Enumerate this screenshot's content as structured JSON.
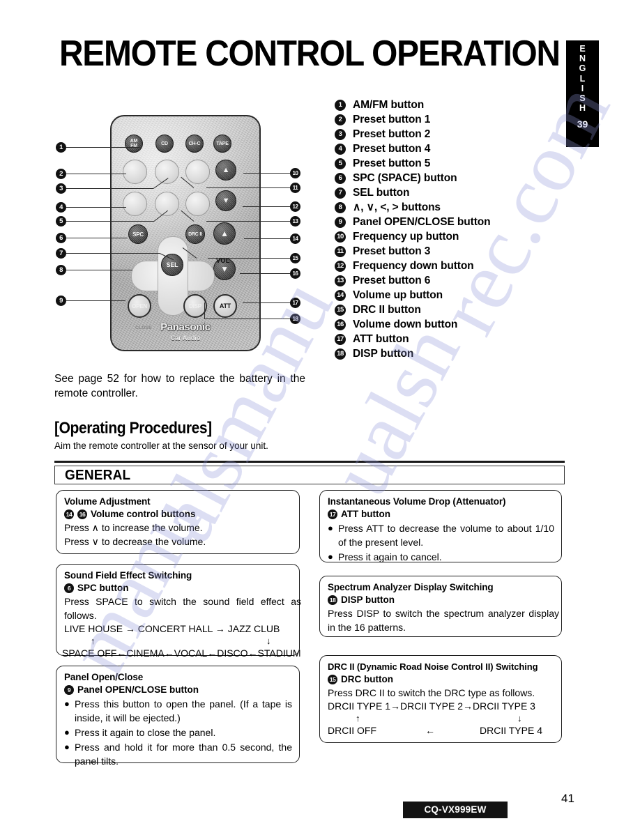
{
  "page": {
    "title": "REMOTE CONTROL OPERATION",
    "number": "41",
    "model_badge": "CQ-VX999EW"
  },
  "english_tab": {
    "letters": [
      "E",
      "N",
      "G",
      "L",
      "I",
      "S",
      "H"
    ],
    "page_ref": "39"
  },
  "remote": {
    "brand": "Panasonic",
    "sub_brand": "Car Audio",
    "vol_label": "VOL",
    "close_label": "CLOSE",
    "top_buttons": [
      "AM\nFM",
      "CD",
      "CH-C",
      "TAPE"
    ],
    "buttons": {
      "spc": "SPC",
      "sel": "SEL",
      "drc": "DRC II",
      "open": "OPEN",
      "disp": "DISP",
      "att": "ATT",
      "vol_up": "▲",
      "vol_down": "▼",
      "freq_up": "▲",
      "freq_down": "▼"
    }
  },
  "legend": [
    {
      "num": "❶",
      "n": "1",
      "label": "AM/FM button"
    },
    {
      "num": "❷",
      "n": "2",
      "label": "Preset button  1"
    },
    {
      "num": "❸",
      "n": "3",
      "label": "Preset button 2"
    },
    {
      "num": "❹",
      "n": "4",
      "label": "Preset button 4"
    },
    {
      "num": "❺",
      "n": "5",
      "label": "Preset button 5"
    },
    {
      "num": "❻",
      "n": "6",
      "label": "SPC (SPACE) button"
    },
    {
      "num": "❼",
      "n": "7",
      "label": "SEL button"
    },
    {
      "num": "❽",
      "n": "8",
      "label": "∧, ∨, <, > buttons"
    },
    {
      "num": "❾",
      "n": "9",
      "label": "Panel OPEN/CLOSE button"
    },
    {
      "num": "❿",
      "n": "10",
      "label": "Frequency up button"
    },
    {
      "num": "➀",
      "n": "11",
      "label": "Preset button 3"
    },
    {
      "num": "➁",
      "n": "12",
      "label": "Frequency down button"
    },
    {
      "num": "➂",
      "n": "13",
      "label": "Preset button 6"
    },
    {
      "num": "➃",
      "n": "14",
      "label": "Volume up button"
    },
    {
      "num": "➄",
      "n": "15",
      "label": "DRC II button"
    },
    {
      "num": "➅",
      "n": "16",
      "label": "Volume down button"
    },
    {
      "num": "➆",
      "n": "17",
      "label": "ATT button"
    },
    {
      "num": "➇",
      "n": "18",
      "label": "DISP button"
    }
  ],
  "battery_note": "See page 52 for how to replace the battery in the remote controller.",
  "operating": {
    "title": "[Operating Procedures]",
    "subtitle": "Aim the remote controller at the sensor of your unit.",
    "section_header": "GENERAL"
  },
  "boxes": {
    "volume": {
      "title": "Volume Adjustment",
      "num_a": "14",
      "num_b": "16",
      "sub": "Volume control buttons",
      "line1": "Press ∧ to increase the volume.",
      "line2": "Press ∨ to decrease the volume."
    },
    "sound_field": {
      "title": "Sound Field Effect Switching",
      "num": "6",
      "sub": "SPC button",
      "line1": "Press SPACE to switch the sound field effect as follows.",
      "flow_top": "LIVE HOUSE  → CONCERT HALL  →  JAZZ CLUB",
      "arrow_up": "↑",
      "arrow_down": "↓",
      "flow_bottom": "SPACE OFF←CINEMA←VOCAL←DISCO←STADIUM"
    },
    "panel": {
      "title": "Panel Open/Close",
      "num": "9",
      "sub": "Panel OPEN/CLOSE button",
      "bullets": [
        "Press this button to open the panel.  (If a tape is inside, it will be ejected.)",
        "Press it again to close the panel.",
        "Press and hold it for more than 0.5 second, the panel tilts."
      ]
    },
    "attenuator": {
      "title": "Instantaneous Volume Drop (Attenuator)",
      "num": "17",
      "sub": "ATT button",
      "bullets": [
        "Press ATT to decrease the volume to about 1/10 of the present level.",
        "Press it again to cancel."
      ]
    },
    "spectrum": {
      "title": "Spectrum Analyzer Display Switching",
      "num": "18",
      "sub": "DISP button",
      "line1": "Press DISP to switch the spectrum analyzer display in the 16 patterns."
    },
    "drc": {
      "title": "DRC II (Dynamic Road Noise Control II) Switching",
      "num": "15",
      "sub": "DRC button",
      "line1": "Press DRC II to switch the DRC type as follows.",
      "flow_top": "DRCII TYPE 1→DRCII TYPE 2→DRCII TYPE 3",
      "arrow_up": "↑",
      "arrow_down": "↓",
      "flow_left": "DRCII OFF",
      "flow_arrow_left": "←",
      "flow_right": "DRCII TYPE  4"
    }
  }
}
